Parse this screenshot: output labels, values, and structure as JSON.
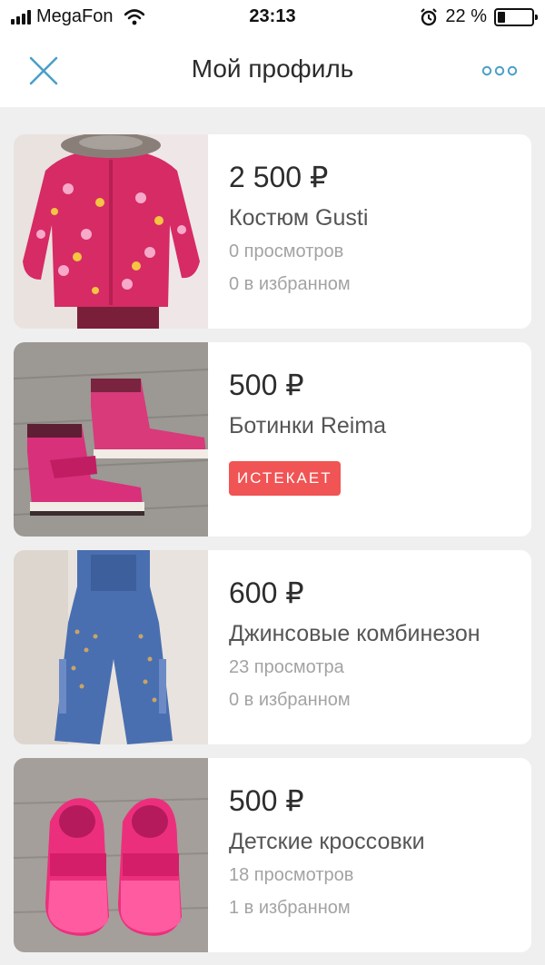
{
  "status_bar": {
    "carrier": "MegaFon",
    "time": "23:13",
    "battery_text": "22 %",
    "battery_level": 0.22,
    "icons": [
      "signal-icon",
      "wifi-icon",
      "alarm-icon",
      "battery-icon"
    ]
  },
  "nav": {
    "title": "Мой профиль",
    "close_icon": "close-icon",
    "more_icon": "more-dots-icon",
    "accent_color": "#4a9fc9"
  },
  "listings": [
    {
      "price": "2 500 ₽",
      "title": "Костюм Gusti",
      "views": "0 просмотров",
      "favorites": "0 в избранном",
      "image": "pink-floral-winter-jacket"
    },
    {
      "price": "500 ₽",
      "title": "Ботинки Reima",
      "badge": "ИСТЕКАЕТ",
      "image": "pink-boots"
    },
    {
      "price": "600 ₽",
      "title": "Джинсовые комбинезон",
      "views": "23 просмотра",
      "favorites": "0 в избранном",
      "image": "denim-overalls"
    },
    {
      "price": "500 ₽",
      "title": "Детские кроссовки",
      "views": "18 просмотров",
      "favorites": "1 в избранном",
      "image": "pink-sneakers"
    }
  ],
  "colors": {
    "badge": "#f05454",
    "background": "#efefef",
    "card": "#ffffff"
  }
}
